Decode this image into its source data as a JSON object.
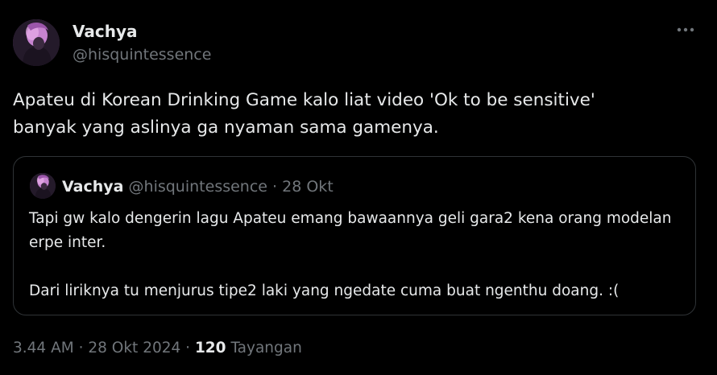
{
  "author": {
    "display_name": "Vachya",
    "handle": "@hisquintessence"
  },
  "tweet": {
    "text": "Apateu di Korean Drinking Game kalo liat video 'Ok to be sensitive'\nbanyak yang aslinya ga nyaman sama gamenya."
  },
  "quote": {
    "display_name": "Vachya",
    "handle": "@hisquintessence",
    "separator": " · ",
    "date": "28 Okt",
    "paragraph_1": "Tapi gw kalo dengerin lagu Apateu emang bawaannya geli gara2 kena orang modelan erpe inter.",
    "paragraph_2": "Dari liriknya tu menjurus tipe2 laki yang ngedate cuma buat ngenthu doang. :("
  },
  "meta": {
    "time": "3.44 AM",
    "separator_1": " · ",
    "date": "28 Okt 2024",
    "separator_2": " · ",
    "views_count": "120",
    "views_label": " Tayangan"
  },
  "icons": {
    "more": "more-horizontal-icon"
  },
  "colors": {
    "background": "#000000",
    "text_primary": "#e7e9ea",
    "text_secondary": "#71767b",
    "border": "#2f3336"
  }
}
